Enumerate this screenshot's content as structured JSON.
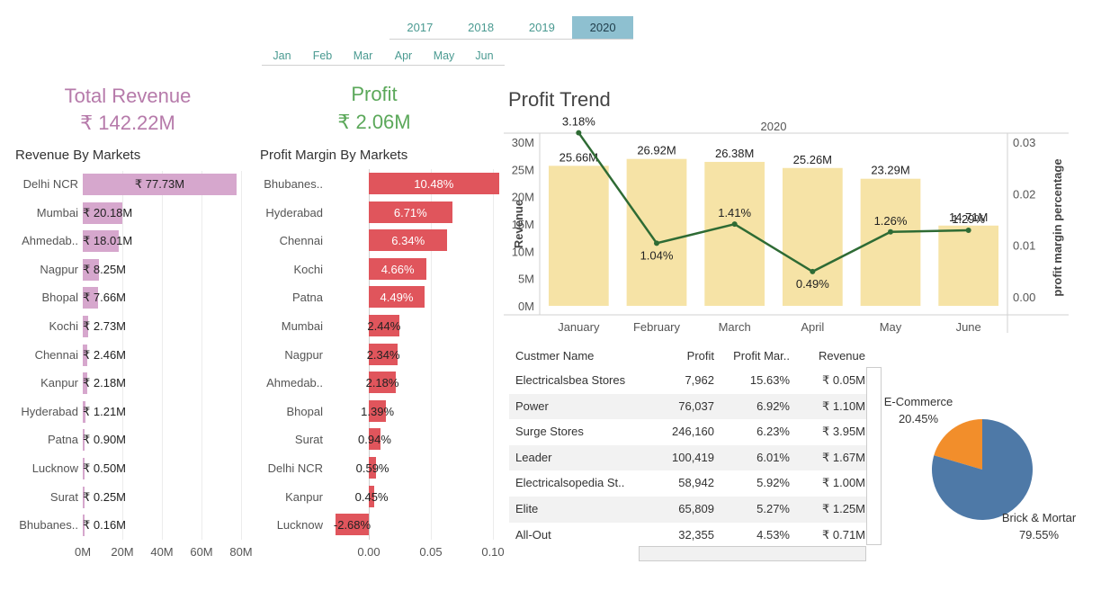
{
  "filters": {
    "years": [
      "2017",
      "2018",
      "2019",
      "2020"
    ],
    "selected_year": "2020",
    "months": [
      "Jan",
      "Feb",
      "Mar",
      "Apr",
      "May",
      "Jun"
    ]
  },
  "kpi": {
    "revenue_title": "Total Revenue",
    "revenue_value": "₹ 142.22M",
    "revenue_color": "#b67aaa",
    "profit_title": "Profit",
    "profit_value": "₹ 2.06M",
    "profit_color": "#5ba85a"
  },
  "revenue_by_markets": {
    "title": "Revenue By Markets",
    "bar_color": "#d6a7cd",
    "markets": [
      "Delhi NCR",
      "Mumbai",
      "Ahmedab..",
      "Nagpur",
      "Bhopal",
      "Kochi",
      "Chennai",
      "Kanpur",
      "Hyderabad",
      "Patna",
      "Lucknow",
      "Surat",
      "Bhubanes.."
    ],
    "values": [
      77.73,
      20.18,
      18.01,
      8.25,
      7.66,
      2.73,
      2.46,
      2.18,
      1.21,
      0.9,
      0.5,
      0.25,
      0.16
    ],
    "labels": [
      "₹ 77.73M",
      "₹ 20.18M",
      "₹ 18.01M",
      "₹ 8.25M",
      "₹ 7.66M",
      "₹ 2.73M",
      "₹ 2.46M",
      "₹ 2.18M",
      "₹ 1.21M",
      "₹ 0.90M",
      "₹ 0.50M",
      "₹ 0.25M",
      "₹ 0.16M"
    ],
    "ticks": [
      "0M",
      "20M",
      "40M",
      "60M",
      "80M"
    ],
    "tick_values": [
      0,
      20,
      40,
      60,
      80
    ]
  },
  "profit_margin_by_markets": {
    "title": "Profit Margin By Markets",
    "bar_color": "#e0555c",
    "markets": [
      "Bhubanes..",
      "Hyderabad",
      "Chennai",
      "Kochi",
      "Patna",
      "Mumbai",
      "Nagpur",
      "Ahmedab..",
      "Bhopal",
      "Surat",
      "Delhi NCR",
      "Kanpur",
      "Lucknow"
    ],
    "values": [
      0.1048,
      0.0671,
      0.0634,
      0.0466,
      0.0449,
      0.0244,
      0.0234,
      0.0218,
      0.0139,
      0.0094,
      0.0059,
      0.0045,
      -0.0268
    ],
    "labels": [
      "10.48%",
      "6.71%",
      "6.34%",
      "4.66%",
      "4.49%",
      "2.44%",
      "2.34%",
      "2.18%",
      "1.39%",
      "0.94%",
      "0.59%",
      "0.45%",
      "-2.68%"
    ],
    "ticks": [
      "0.00",
      "0.05",
      "0.10"
    ],
    "tick_values": [
      0,
      0.05,
      0.1
    ]
  },
  "chart_data": {
    "type": "bar",
    "title": "Profit Trend",
    "header": "2020",
    "categories": [
      "January",
      "February",
      "March",
      "April",
      "May",
      "June"
    ],
    "series": [
      {
        "name": "Revenue",
        "type": "bar",
        "values": [
          25.66,
          26.92,
          26.38,
          25.26,
          23.29,
          14.71
        ],
        "labels": [
          "25.66M",
          "26.92M",
          "26.38M",
          "25.26M",
          "23.29M",
          "14.71M"
        ],
        "color": "#f6e3a6"
      },
      {
        "name": "profit margin percentage",
        "type": "line",
        "values": [
          0.0318,
          0.0104,
          0.0141,
          0.0049,
          0.0126,
          0.0129
        ],
        "labels": [
          "3.18%",
          "1.04%",
          "1.41%",
          "0.49%",
          "1.26%",
          "1.29%"
        ],
        "color": "#2e6b34"
      }
    ],
    "ylabel": "Revenue",
    "y2label": "profit margin percentage",
    "ylim": [
      0,
      30
    ],
    "y2lim": [
      0,
      0.03
    ],
    "yticks": [
      "0M",
      "5M",
      "10M",
      "15M",
      "20M",
      "25M",
      "30M"
    ],
    "y2ticks": [
      "0.00",
      "0.01",
      "0.02",
      "0.03"
    ]
  },
  "table": {
    "headers": [
      "Custmer Name",
      "Profit",
      "Profit Mar..",
      "Revenue"
    ],
    "rows": [
      [
        "Electricalsbea Stores",
        "7,962",
        "15.63%",
        "₹ 0.05M"
      ],
      [
        "Power",
        "76,037",
        "6.92%",
        "₹ 1.10M"
      ],
      [
        "Surge Stores",
        "246,160",
        "6.23%",
        "₹ 3.95M"
      ],
      [
        "Leader",
        "100,419",
        "6.01%",
        "₹ 1.67M"
      ],
      [
        "Electricalsopedia St..",
        "58,942",
        "5.92%",
        "₹ 1.00M"
      ],
      [
        "Elite",
        "65,809",
        "5.27%",
        "₹ 1.25M"
      ],
      [
        "All-Out",
        "32,355",
        "4.53%",
        "₹ 0.71M"
      ]
    ]
  },
  "pie": {
    "slices": [
      {
        "name": "E-Commerce",
        "value": 20.45,
        "label": "20.45%",
        "color": "#f28e2b"
      },
      {
        "name": "Brick & Mortar",
        "value": 79.55,
        "label": "79.55%",
        "color": "#4e79a7"
      }
    ]
  }
}
